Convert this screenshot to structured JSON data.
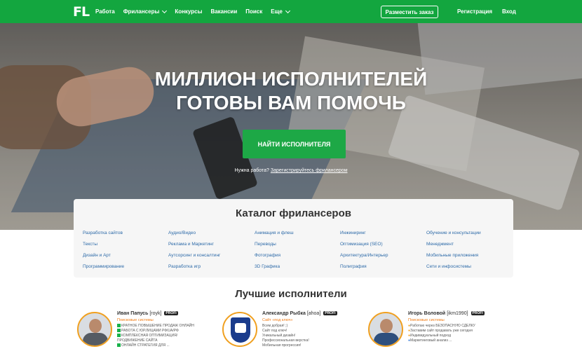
{
  "nav": {
    "logo": "FL",
    "links": [
      {
        "label": "Работа",
        "dropdown": false
      },
      {
        "label": "Фрилансеры",
        "dropdown": true
      },
      {
        "label": "Конкурсы",
        "dropdown": false
      },
      {
        "label": "Вакансии",
        "dropdown": false
      },
      {
        "label": "Поиск",
        "dropdown": false
      },
      {
        "label": "Еще",
        "dropdown": true
      }
    ],
    "post_button": "Разместить заказ",
    "register": "Регистрация",
    "login": "Вход"
  },
  "hero": {
    "title_line1": "МИЛЛИОН ИСПОЛНИТЕЛЕЙ",
    "title_line2": "ГОТОВЫ ВАМ ПОМОЧЬ",
    "button": "НАЙТИ ИСПОЛНИТЕЛЯ",
    "sub_text": "Нужна работа?",
    "sub_link": "Зарегистрируйтесь фрилансером"
  },
  "catalog": {
    "title": "Каталог фрилансеров",
    "items": [
      "Разработка сайтов",
      "Аудио/Видео",
      "Анимация и флеш",
      "Инжиниринг",
      "Обучение и консультации",
      "Тексты",
      "Реклама и Маркетинг",
      "Переводы",
      "Оптимизация (SEO)",
      "Менеджмент",
      "Дизайн и Арт",
      "Аутсорсинг и консалтинг",
      "Фотография",
      "Архитектура/Интерьер",
      "Мобильные приложения",
      "Программирование",
      "Разработка игр",
      "3D Графика",
      "Полиграфия",
      "Сети и инфосистемы"
    ]
  },
  "best": {
    "title": "Лучшие исполнители",
    "performers": [
      {
        "name": "Иван Папусь",
        "login": "[royk]",
        "badge": "PROFI",
        "category": "Поисковые системы",
        "lines": [
          "КРАТНОЕ ПОВЫШЕНИЕ ПРОДАЖ ОНЛАЙН",
          "РАБОТА С ЮР.ЛИЦАМИ РФ/UA/РФ",
          "КОМПЛЕКСНАЯ ОПТИМИЗАЦИЯ/",
          "ПРОДВИЖЕНИЕ САЙТА",
          "ОНЛАЙН СТРАТЕГИЯ ДЛЯ ..."
        ],
        "checks": [
          true,
          true,
          true,
          false,
          true
        ],
        "avatar": "person"
      },
      {
        "name": "Александр Рыбка",
        "login": "[ahoa]",
        "badge": "PROFI",
        "category": "Сайт «под ключ»",
        "lines": [
          "Всем добрая! ;)",
          "Сайт под ключ!",
          "Уникальный дизайн!",
          "Профессиональная верстка!",
          "Мобильная прогрессия!"
        ],
        "checks": [
          false,
          false,
          false,
          false,
          false
        ],
        "avatar": "crest"
      },
      {
        "name": "Игорь Воловой",
        "login": "[ikm1990]",
        "badge": "PROFI",
        "category": "Поисковые системы",
        "lines": [
          "Работаю через БЕЗОПАСНУЮ СДЕЛКУ",
          "Заставим сайт продавать уже сегодня",
          "Индивидуальный подход",
          "Маркетинговый анализ ..."
        ],
        "checks": [
          false,
          false,
          false,
          false
        ],
        "avatar": "suit"
      }
    ]
  },
  "colors": {
    "brand_green": "#13a63f",
    "button_green": "#1da846",
    "link_blue": "#2d6aa8",
    "accent_orange": "#f07b14"
  }
}
